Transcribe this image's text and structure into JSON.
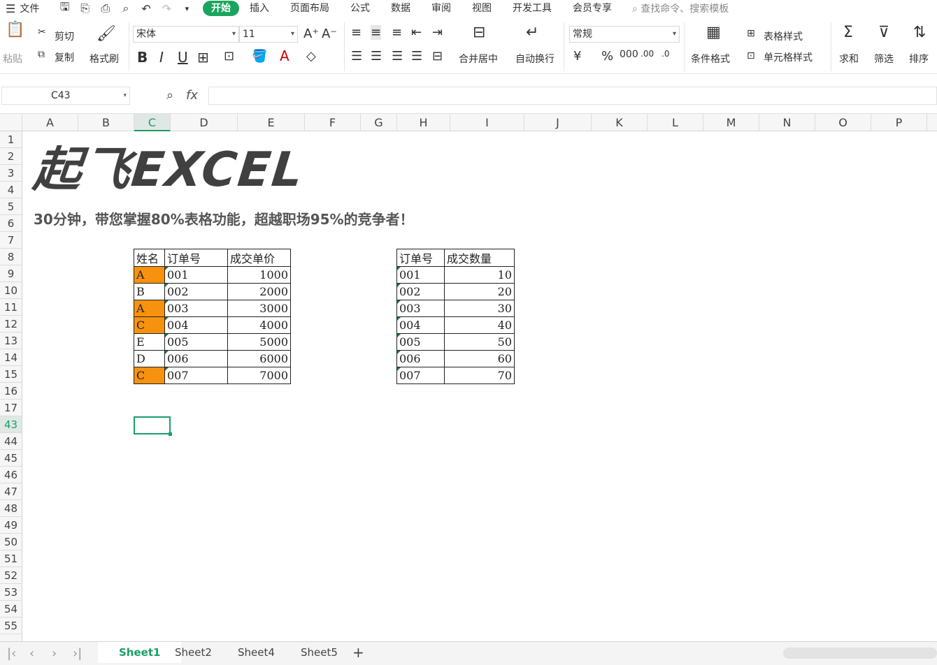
{
  "menubar": {
    "file": "文件",
    "tabs": [
      "开始",
      "插入",
      "页面布局",
      "公式",
      "数据",
      "审阅",
      "视图",
      "开发工具",
      "会员专享"
    ],
    "search_placeholder": "查找命令、搜索模板"
  },
  "ribbon": {
    "paste": "粘贴",
    "cut": "剪切",
    "copy": "复制",
    "format_painter": "格式刷",
    "font_name": "宋体",
    "font_size": "11",
    "merge_center": "合并居中",
    "wrap_text": "自动换行",
    "number_format": "常规",
    "conditional_format": "条件格式",
    "table_style": "表格样式",
    "cell_style": "单元格样式",
    "sum": "求和",
    "filter": "筛选",
    "sort": "排序"
  },
  "formula_bar": {
    "name_box": "C43",
    "fx": "fx",
    "formula": ""
  },
  "columns": [
    "A",
    "B",
    "C",
    "D",
    "E",
    "F",
    "G",
    "H",
    "I",
    "J",
    "K",
    "L",
    "M",
    "N",
    "O",
    "P"
  ],
  "rows": [
    "1",
    "2",
    "3",
    "4",
    "5",
    "6",
    "7",
    "8",
    "9",
    "10",
    "11",
    "12",
    "13",
    "14",
    "15",
    "16",
    "17",
    "43",
    "44",
    "45",
    "46",
    "47",
    "48",
    "49",
    "50",
    "51",
    "52",
    "53",
    "54",
    "55"
  ],
  "logo_text": "起飞EXCEL",
  "slogan": "30分钟，带您掌握80%表格功能，超越职场95%的竞争者！",
  "table1": {
    "headers": [
      "姓名",
      "订单号",
      "成交单价"
    ],
    "rows": [
      [
        "A",
        "001",
        "1000"
      ],
      [
        "B",
        "002",
        "2000"
      ],
      [
        "A",
        "003",
        "3000"
      ],
      [
        "C",
        "004",
        "4000"
      ],
      [
        "E",
        "005",
        "5000"
      ],
      [
        "D",
        "006",
        "6000"
      ],
      [
        "C",
        "007",
        "7000"
      ]
    ]
  },
  "table2": {
    "headers": [
      "订单号",
      "成交数量"
    ],
    "rows": [
      [
        "001",
        "10"
      ],
      [
        "002",
        "20"
      ],
      [
        "003",
        "30"
      ],
      [
        "004",
        "40"
      ],
      [
        "005",
        "50"
      ],
      [
        "006",
        "60"
      ],
      [
        "007",
        "70"
      ]
    ]
  },
  "sheets": [
    "Sheet1",
    "Sheet2",
    "Sheet4",
    "Sheet5"
  ],
  "colors": {
    "accent": "#1aa55f",
    "highlight": "#f7920f"
  }
}
